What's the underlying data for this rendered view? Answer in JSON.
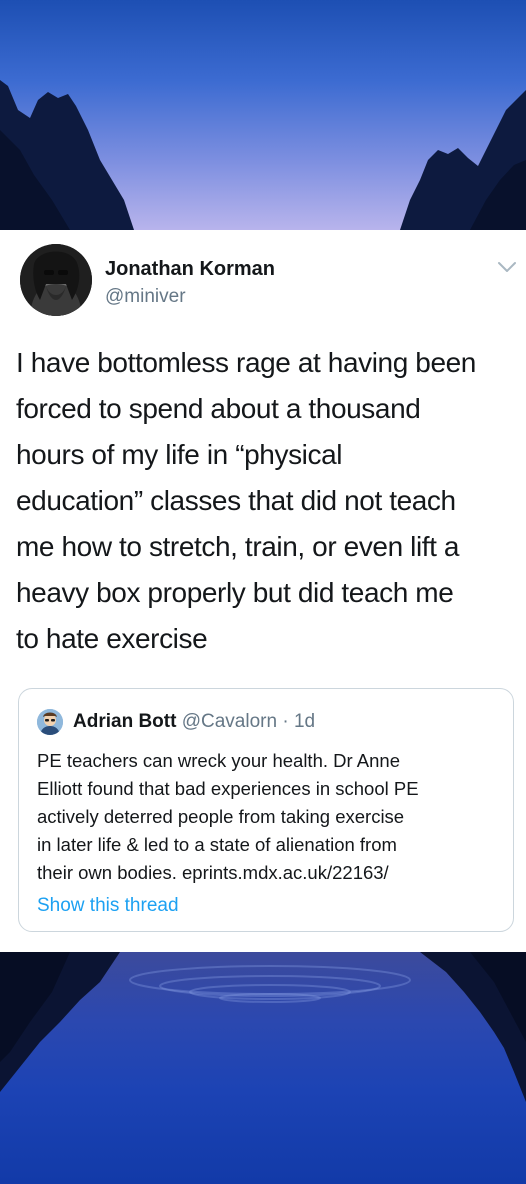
{
  "tweet": {
    "author_name": "Jonathan Korman",
    "author_handle": "@miniver",
    "text": "I have bottomless rage at having been\nforced to spend about a thousand\nhours of my life in “physical\neducation” classes that did not teach\nme how to stretch, train, or even lift a\nheavy box properly but did teach me\nto hate exercise"
  },
  "quote": {
    "author_name": "Adrian Bott",
    "author_handle": "@Cavalorn",
    "separator": " · ",
    "age": "1d",
    "text": "PE teachers can wreck your health. Dr Anne\nElliott found that bad experiences in school PE\nactively deterred people from taking exercise\nin later life & led to a state of alienation from\ntheir own bodies. eprints.mdx.ac.uk/22163/",
    "link_label": "Show this thread"
  },
  "colors": {
    "text_primary": "#14171a",
    "text_secondary": "#657786",
    "link": "#1da1f2",
    "border": "#ccd6dd"
  },
  "icons": {
    "menu": "chevron-down-icon"
  }
}
